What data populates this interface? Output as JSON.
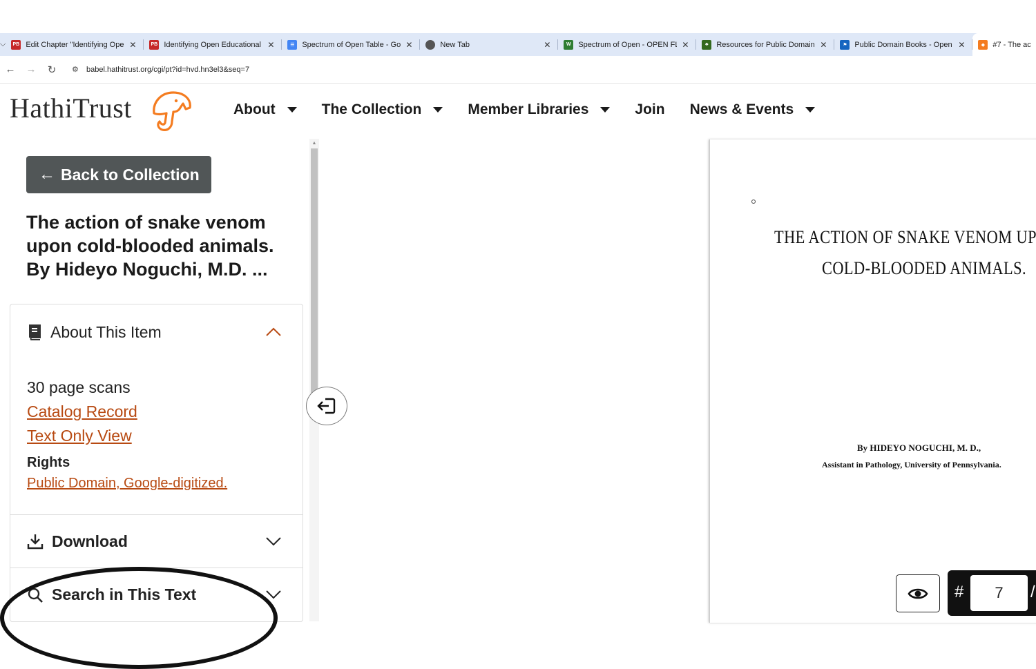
{
  "browser": {
    "tabs": [
      {
        "title": "Edit Chapter \"Identifying Open",
        "favicon": "pb-icon",
        "color": "#c62828",
        "active": false
      },
      {
        "title": "Identifying Open Educational R",
        "favicon": "pb-icon",
        "color": "#c62828",
        "active": false
      },
      {
        "title": "Spectrum of Open Table - Goog",
        "favicon": "docs-icon",
        "color": "#4285f4",
        "active": false
      },
      {
        "title": "New Tab",
        "favicon": "chrome-icon",
        "color": "#555555",
        "active": false
      },
      {
        "title": "Spectrum of Open - OPEN FL -",
        "favicon": "openfl-icon",
        "color": "#2e7d32",
        "active": false
      },
      {
        "title": "Resources for Public Domain M",
        "favicon": "resources-icon",
        "color": "#33691e",
        "active": false
      },
      {
        "title": "Public Domain Books - Open Ec",
        "favicon": "flag-icon",
        "color": "#1565c0",
        "active": false
      },
      {
        "title": "#7 - The ac",
        "favicon": "hathitrust-icon",
        "color": "#f47c20",
        "active": true
      }
    ],
    "url": "babel.hathitrust.org/cgi/pt?id=hvd.hn3el3&seq=7"
  },
  "header": {
    "logo": "HathiTrust",
    "nav": [
      {
        "label": "About",
        "dropdown": true
      },
      {
        "label": "The Collection",
        "dropdown": true
      },
      {
        "label": "Member Libraries",
        "dropdown": true
      },
      {
        "label": "Join",
        "dropdown": false
      },
      {
        "label": "News & Events",
        "dropdown": true
      }
    ]
  },
  "sidebar": {
    "back_label": "Back to Collection",
    "title": "The action of snake venom upon cold-blooded animals. By Hideyo Noguchi, M.D. ...",
    "about": {
      "heading": "About This Item",
      "scans": "30 page scans",
      "catalog_link": "Catalog Record",
      "text_only_link": "Text Only View",
      "rights_heading": "Rights",
      "rights_link": "Public Domain, Google-digitized."
    },
    "download": "Download",
    "search": "Search in This Text"
  },
  "scan": {
    "title_line1": "THE ACTION OF SNAKE VENOM UPON",
    "title_line2": "COLD-BLOODED ANIMALS.",
    "author": "By HIDEYO NOGUCHI, M. D.,",
    "affiliation": "Assistant in Pathology, University of Pennsylvania."
  },
  "controls": {
    "page_hash": "#",
    "page_value": "7",
    "page_slash": "/"
  },
  "colors": {
    "accent": "#f47c20",
    "link": "#b84a12",
    "back_button": "#515657"
  }
}
